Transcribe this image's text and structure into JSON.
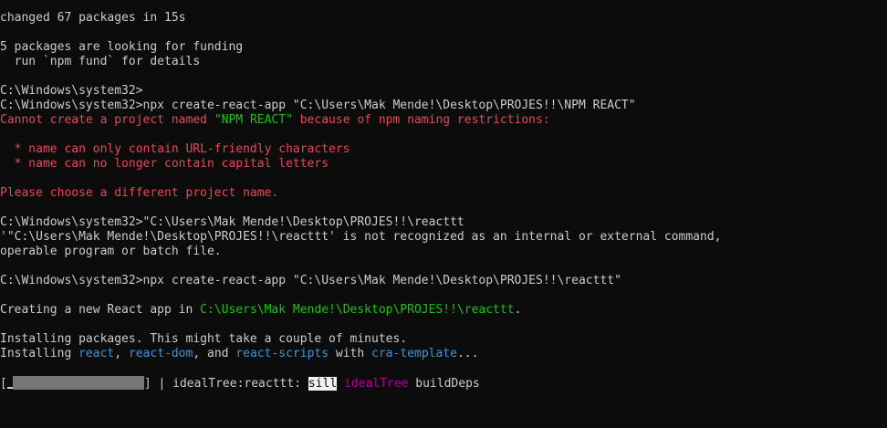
{
  "terminal": {
    "summary_changed": "changed 67 packages in 15s",
    "funding_line1": "5 packages are looking for funding",
    "funding_line2": "  run `npm fund` for details",
    "prompt_empty": "C:\\Windows\\system32>",
    "cmd1": "C:\\Windows\\system32>npx create-react-app \"C:\\Users\\Mak Mende!\\Desktop\\PROJES!!\\NPM REACT\"",
    "err_prefix": "Cannot create a project named ",
    "err_name": "\"NPM REACT\"",
    "err_suffix": " because of npm naming restrictions:",
    "err_bullet1": "  * name can only contain URL-friendly characters",
    "err_bullet2": "  * name can no longer contain capital letters",
    "err_choose": "Please choose a different project name.",
    "cmd2": "C:\\Windows\\system32>\"C:\\Users\\Mak Mende!\\Desktop\\PROJES!!\\reacttt",
    "cmd2_err1": "'\"C:\\Users\\Mak Mende!\\Desktop\\PROJES!!\\reacttt' is not recognized as an internal or external command,",
    "cmd2_err2": "operable program or batch file.",
    "cmd3": "C:\\Windows\\system32>npx create-react-app \"C:\\Users\\Mak Mende!\\Desktop\\PROJES!!\\reacttt\"",
    "creating_prefix": "Creating a new React app in ",
    "creating_path": "C:\\Users\\Mak Mende!\\Desktop\\PROJES!!\\reacttt",
    "creating_suffix": ".",
    "installing_line": "Installing packages. This might take a couple of minutes.",
    "install_prefix": "Installing ",
    "pkg_react": "react",
    "sep_comma": ", ",
    "pkg_react_dom": "react-dom",
    "sep_and": ", and ",
    "pkg_react_scripts": "react-scripts",
    "with_word": " with ",
    "pkg_template": "cra-template",
    "ellipsis": "...",
    "progress_open": "[",
    "progress_close": "]",
    "progress_sep": " | ",
    "progress_stage": "idealTree:reacttt: ",
    "progress_level": "sill",
    "progress_space": " ",
    "progress_task": "idealTree",
    "progress_detail": " buildDeps"
  },
  "colors": {
    "background": "#0c0c0c",
    "text": "#cccccc",
    "error_red": "#e74856",
    "path_green": "#16c60c",
    "package_cyan": "#3a96dd",
    "task_purple": "#b4009e",
    "progress_bar": "#767676"
  }
}
